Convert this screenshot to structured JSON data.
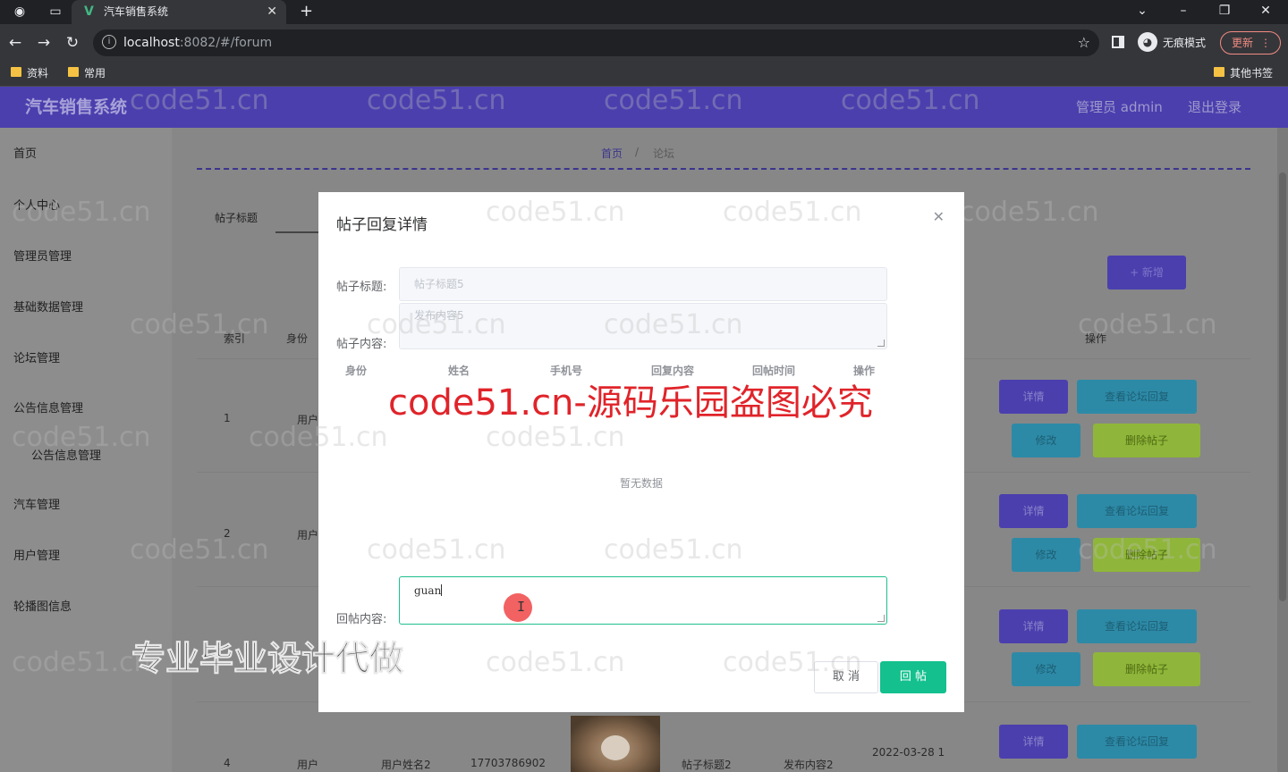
{
  "browser": {
    "tab_title": "汽车销售系统",
    "url_host": "localhost",
    "url_rest": ":8082/#/forum",
    "incognito_label": "无痕模式",
    "update_label": "更新",
    "bookmarks": [
      "资料",
      "常用"
    ],
    "other_bookmarks": "其他书签"
  },
  "app": {
    "title": "汽车销售系统",
    "admin_label": "管理员 admin",
    "logout_label": "退出登录"
  },
  "sidebar": {
    "items": [
      "首页",
      "个人中心",
      "管理员管理",
      "基础数据管理",
      "论坛管理",
      "公告信息管理",
      "公告信息管理",
      "汽车管理",
      "用户管理",
      "轮播图信息"
    ]
  },
  "breadcrumb": {
    "home": "首页",
    "separator": "/",
    "current": "论坛"
  },
  "toolbar": {
    "search_label": "帖子标题",
    "add_label": "+ 新增"
  },
  "table": {
    "headers": [
      "索引",
      "身份",
      "操作"
    ],
    "rows": [
      {
        "index": "1",
        "identity": "用户"
      },
      {
        "index": "2",
        "identity": "用户"
      },
      {
        "index": "4",
        "identity": "用户",
        "name": "用户姓名2",
        "phone": "17703786902",
        "title": "帖子标题2",
        "content": "发布内容2",
        "time": "2022-03-28 1"
      }
    ],
    "action_labels": {
      "detail": "详情",
      "reply": "查看论坛回复",
      "edit": "修改",
      "delete": "删除帖子"
    }
  },
  "dialog": {
    "title": "帖子回复详情",
    "title_label": "帖子标题:",
    "title_placeholder": "帖子标题5",
    "content_label": "帖子内容:",
    "content_placeholder": "发布内容5",
    "columns": [
      "身份",
      "姓名",
      "手机号",
      "回复内容",
      "回帖时间",
      "操作"
    ],
    "empty_text": "暂无数据",
    "reply_label": "回帖内容:",
    "reply_value": "guan",
    "cancel_label": "取 消",
    "submit_label": "回 帖"
  },
  "watermarks": {
    "faint": "code51.cn",
    "red": "code51.cn-源码乐园盗图必究",
    "ad": "专业毕业设计代做"
  },
  "colors": {
    "header_bg": "#4b3fae",
    "primary_green": "#13c08e",
    "watermark_red": "#e0242a"
  }
}
